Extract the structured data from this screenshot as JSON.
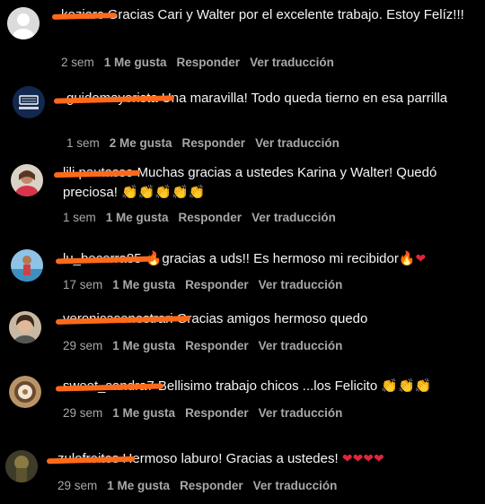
{
  "colors": {
    "background": "#000000",
    "text": "#f5f5f5",
    "meta": "#a8a8a8",
    "redaction": "#ff6a1a",
    "heart": "#e0243b"
  },
  "comments": [
    {
      "username": "koziarc",
      "text": "Gracias Cari y Walter por el excelente trabajo. Estoy Felíz!!!",
      "time": "2 sem",
      "likes": "1 Me gusta",
      "reply": "Responder",
      "translate": "Ver traducción"
    },
    {
      "username": "guidomayorista",
      "text": "Una maravilla! Todo queda tierno en esa parrilla",
      "time": "1 sem",
      "likes": "2 Me gusta",
      "reply": "Responder",
      "translate": "Ver traducción"
    },
    {
      "username": "lili.pautasso",
      "text": "Muchas gracias a ustedes Karina y Walter! Quedó preciosa! 👏👏👏👏👏",
      "time": "1 sem",
      "likes": "1 Me gusta",
      "reply": "Responder",
      "translate": "Ver traducción"
    },
    {
      "username": "lu_becerra85",
      "text": "🔥gracias a uds!! Es hermoso mi recibidor🔥❤",
      "time": "17 sem",
      "likes": "1 Me gusta",
      "reply": "Responder",
      "translate": "Ver traducción"
    },
    {
      "username": "veronicasenestrari",
      "text": "Gracias amigos hermoso quedo",
      "time": "29 sem",
      "likes": "1 Me gusta",
      "reply": "Responder",
      "translate": "Ver traducción"
    },
    {
      "username": "sweet_sandra7",
      "text": "Bellisimo trabajo chicos ...los Felicito 👏👏👏",
      "time": "29 sem",
      "likes": "1 Me gusta",
      "reply": "Responder",
      "translate": "Ver traducción"
    },
    {
      "username": "zulofreites",
      "text": "Hermoso laburo! Gracias a ustedes! ❤❤❤❤",
      "time": "29 sem",
      "likes": "1 Me gusta",
      "reply": "Responder",
      "translate": "Ver traducción"
    }
  ]
}
